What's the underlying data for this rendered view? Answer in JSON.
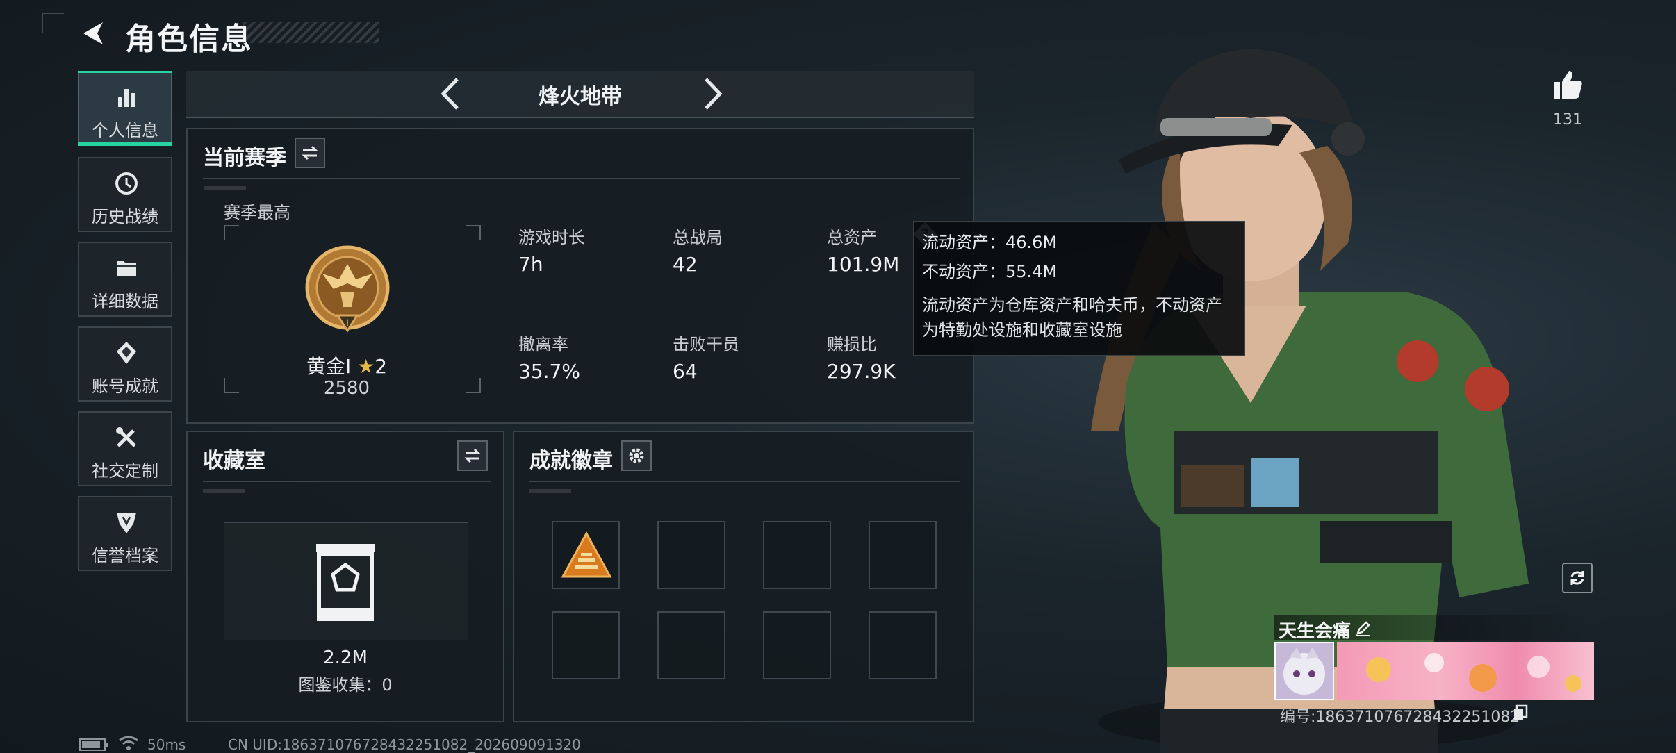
{
  "header": {
    "title": "角色信息"
  },
  "sidebar": {
    "items": [
      {
        "label": "个人信息",
        "icon": "bar-chart-icon"
      },
      {
        "label": "历史战绩",
        "icon": "history-clock-icon"
      },
      {
        "label": "详细数据",
        "icon": "folder-icon"
      },
      {
        "label": "账号成就",
        "icon": "achievement-icon"
      },
      {
        "label": "社交定制",
        "icon": "tools-icon"
      },
      {
        "label": "信誉档案",
        "icon": "shield-icon"
      }
    ]
  },
  "mode": {
    "title": "烽火地带"
  },
  "season": {
    "title": "当前赛季",
    "best_label": "赛季最高",
    "rank_name": "黄金Ⅰ",
    "rank_stars": "2",
    "rank_score": "2580",
    "stats": [
      {
        "label": "游戏时长",
        "value": "7h"
      },
      {
        "label": "总战局",
        "value": "42"
      },
      {
        "label": "总资产",
        "value": "101.9M"
      },
      {
        "label": "撤离率",
        "value": "35.7%"
      },
      {
        "label": "击败干员",
        "value": "64"
      },
      {
        "label": "赚损比",
        "value": "297.9K"
      }
    ]
  },
  "tooltip": {
    "liquid": "流动资产：46.6M",
    "fixed": "不动资产：55.4M",
    "note": "流动资产为仓库资产和哈夫币，不动资产为特勤处设施和收藏室设施"
  },
  "collection": {
    "title": "收藏室",
    "value": "2.2M",
    "count_text": "图鉴收集：0"
  },
  "badges": {
    "title": "成就徽章",
    "slots": 8
  },
  "likes": {
    "count": "131"
  },
  "player": {
    "name": "天生会痛",
    "id_text": "编号:186371076728432251082"
  },
  "status": {
    "ping": "50ms",
    "uid": "CN UID:186371076728432251082_202609091320"
  },
  "colors": {
    "accent": "#27d3a0",
    "tooltip_bg": "#0a0c0e"
  }
}
